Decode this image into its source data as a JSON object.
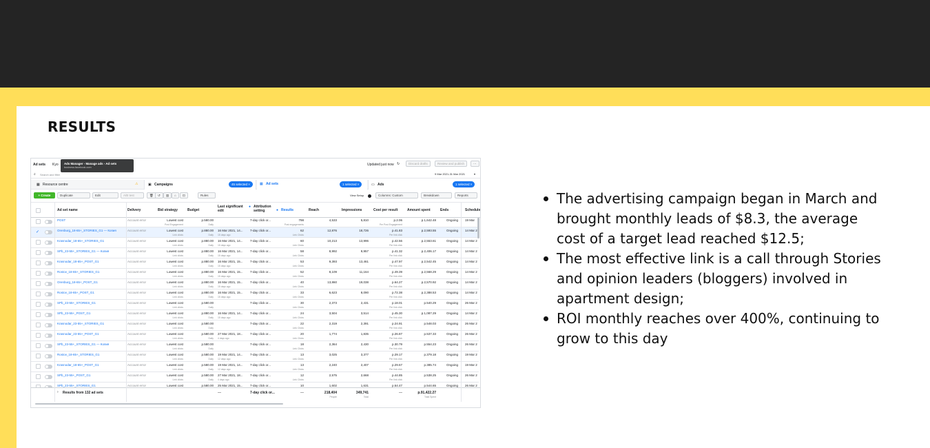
{
  "title": "RESULTS",
  "bullets": [
    "The advertising campaign began in March and brought monthly leads of $8.3, the average cost of a target lead reached $12.5;",
    "The most effective link is a call through Stories and opinion leaders (bloggers) involved in apartment design;",
    "ROI monthly reaches over 400%, continuing to grow to this day"
  ],
  "colors": {
    "top_band": "#242424",
    "accent_yellow": "#ffde59",
    "fb_blue": "#1877f2",
    "create_green": "#42b72a"
  },
  "ads": {
    "breadcrumb": "Ad sets",
    "breadcrumb_partial": "Kyo",
    "tooltip_title": "Ads Manager - Manage ads - Ad sets",
    "tooltip_url": "business.facebook.com",
    "search_placeholder": "Search and filter",
    "updated": "Updated just now",
    "discard": "Discard drafts",
    "review": "Review and publish",
    "more": "···",
    "date_range": "9 Mar 2021-31 Mar 2021",
    "resource_centre": "Resource centre",
    "campaigns_tab": "Campaigns",
    "campaigns_selected": "45 selected ×",
    "adsets_tab": "Ad sets",
    "adsets_selected": "1 selected ×",
    "ads_tab": "Ads",
    "ads_selected": "1 selected ×",
    "toolbar": {
      "create": "+ Create",
      "duplicate": "Duplicate",
      "edit": "Edit",
      "ab_test": "A/B test",
      "rules": "Rules",
      "view_setup": "View Setup",
      "columns": "Columns: Custom",
      "breakdown": "Breakdown",
      "reports": "Reports"
    },
    "columns": [
      "Ad set name",
      "Delivery",
      "Bid strategy",
      "Budget",
      "Last significant edit",
      "Attribution setting",
      "Results",
      "Reach",
      "Impressions",
      "Cost per result",
      "Amount spent",
      "Ends",
      "Schedule"
    ],
    "first_row": {
      "name": "POST",
      "delivery": "Account error",
      "bid": "Lowest cost",
      "bid_sub": "Post Engagement",
      "budget": "p.580.00",
      "budget_sub": "Daily",
      "edit": "",
      "edit_sub": "",
      "attr": "7-day click or...",
      "results": "798",
      "results_sub": "Post engagements",
      "reach": "4,533",
      "impr": "5,810",
      "cpr": "p.2.06",
      "cpr_sub": "Per Post Engagement",
      "spent": "p.1,642.48",
      "ends": "Ongoing",
      "sched": "19 Mar"
    },
    "rows": [
      {
        "name": "Orenburg_18-65+_STORIES_G1 — Копия",
        "delivery": "Account error",
        "bid": "Lowest cost",
        "bid_sub": "Link clicks",
        "budget": "p.880.00",
        "budget_sub": "Daily",
        "edit": "16 Mar 2021, 14...",
        "edit_sub": "15 days ago",
        "attr": "7-day click or...",
        "results": "62",
        "results_sub": "Link Clicks",
        "reach": "12,876",
        "impr": "18,726",
        "cpr": "p.41.83",
        "cpr_sub": "Per link click",
        "spent": "p.2,593.55",
        "ends": "Ongoing",
        "sched": "14 Mar 2"
      },
      {
        "name": "Krasnodar_18-65+_STORIES_G1",
        "delivery": "Account error",
        "bid": "Lowest cost",
        "bid_sub": "Link clicks",
        "budget": "p.880.00",
        "budget_sub": "Daily",
        "edit": "16 Mar 2021, 14...",
        "edit_sub": "15 days ago",
        "attr": "7-day click or...",
        "results": "60",
        "results_sub": "Link Clicks",
        "reach": "10,213",
        "impr": "13,996",
        "cpr": "p.42.56",
        "cpr_sub": "Per link click",
        "spent": "p.2,553.61",
        "ends": "Ongoing",
        "sched": "14 Mar 2"
      },
      {
        "name": "SPb_23-55+_STORIES_G1 — Копия",
        "delivery": "Account error",
        "bid": "Lowest cost",
        "bid_sub": "Link clicks",
        "budget": "p.880.00",
        "budget_sub": "Daily",
        "edit": "16 Mar 2021, 14...",
        "edit_sub": "15 days ago",
        "attr": "7-day click or...",
        "results": "58",
        "results_sub": "Link Clicks",
        "reach": "8,992",
        "impr": "9,957",
        "cpr": "p.41.32",
        "cpr_sub": "Per link click",
        "spent": "p.2,406.17",
        "ends": "Ongoing",
        "sched": "14 Mar 2"
      },
      {
        "name": "Krasnodar_18-65+_POST_G1",
        "delivery": "Account error",
        "bid": "Lowest cost",
        "bid_sub": "Link clicks",
        "budget": "p.880.00",
        "budget_sub": "Daily",
        "edit": "16 Mar 2021, 15...",
        "edit_sub": "15 days ago",
        "attr": "7-day click or...",
        "results": "53",
        "results_sub": "Link Clicks",
        "reach": "9,393",
        "impr": "13,461",
        "cpr": "p.47.97",
        "cpr_sub": "Per link click",
        "spent": "p.2,542.45",
        "ends": "Ongoing",
        "sched": "14 Mar 2"
      },
      {
        "name": "Rostov_18-65+_STORIES_G1",
        "delivery": "Account error",
        "bid": "Lowest cost",
        "bid_sub": "Link clicks",
        "budget": "p.880.00",
        "budget_sub": "Daily",
        "edit": "16 Mar 2021, 15...",
        "edit_sub": "15 days ago",
        "attr": "7-day click or...",
        "results": "52",
        "results_sub": "Link Clicks",
        "reach": "8,109",
        "impr": "11,164",
        "cpr": "p.49.39",
        "cpr_sub": "Per link click",
        "spent": "p.2,568.29",
        "ends": "Ongoing",
        "sched": "14 Mar 2"
      },
      {
        "name": "Orenburg_18-65+_POST_G1",
        "delivery": "Account error",
        "bid": "Lowest cost",
        "bid_sub": "Link clicks",
        "budget": "p.880.00",
        "budget_sub": "Daily",
        "edit": "16 Mar 2021, 15...",
        "edit_sub": "15 days ago",
        "attr": "7-day click or...",
        "results": "40",
        "results_sub": "Link Clicks",
        "reach": "13,860",
        "impr": "19,038",
        "cpr": "p.64.27",
        "cpr_sub": "Per link click",
        "spent": "p.2,570.92",
        "ends": "Ongoing",
        "sched": "14 Mar 2"
      },
      {
        "name": "Rostov_18-65+_POST_G1",
        "delivery": "Account error",
        "bid": "Lowest cost",
        "bid_sub": "Link clicks",
        "budget": "p.880.00",
        "budget_sub": "Daily",
        "edit": "16 Mar 2021, 15...",
        "edit_sub": "15 days ago",
        "attr": "7-day click or...",
        "results": "33",
        "results_sub": "Link Clicks",
        "reach": "6,623",
        "impr": "8,090",
        "cpr": "p.72.38",
        "cpr_sub": "Per link click",
        "spent": "p.2,388.53",
        "ends": "Ongoing",
        "sched": "14 Mar 2"
      },
      {
        "name": "SPb_23-55+_STORIES_G1",
        "delivery": "Account error",
        "bid": "Lowest cost",
        "bid_sub": "Link clicks",
        "budget": "p.580.00",
        "budget_sub": "Daily",
        "edit": "",
        "edit_sub": "",
        "attr": "7-day click or...",
        "results": "30",
        "results_sub": "Link Clicks",
        "reach": "2,373",
        "impr": "2,431",
        "cpr": "p.18.01",
        "cpr_sub": "Per link click",
        "spent": "p.540.29",
        "ends": "Ongoing",
        "sched": "26 Mar 2"
      },
      {
        "name": "SPb_23-55+_POST_G1",
        "delivery": "Account error",
        "bid": "Lowest cost",
        "bid_sub": "Link clicks",
        "budget": "p.880.00",
        "budget_sub": "Daily",
        "edit": "16 Mar 2021, 14...",
        "edit_sub": "15 days ago",
        "attr": "7-day click or...",
        "results": "24",
        "results_sub": "Link Clicks",
        "reach": "3,504",
        "impr": "3,514",
        "cpr": "p.45.30",
        "cpr_sub": "Per link click",
        "spent": "p.1,087.29",
        "ends": "Ongoing",
        "sched": "14 Mar 2"
      },
      {
        "name": "Krasnodar_23-55+_STORIES_G1",
        "delivery": "Account error",
        "bid": "Lowest cost",
        "bid_sub": "Link clicks",
        "budget": "p.580.00",
        "budget_sub": "Daily",
        "edit": "",
        "edit_sub": "",
        "attr": "7-day click or...",
        "results": "22",
        "results_sub": "Link Clicks",
        "reach": "2,319",
        "impr": "2,391",
        "cpr": "p.24.91",
        "cpr_sub": "Per link click",
        "spent": "p.548.03",
        "ends": "Ongoing",
        "sched": "26 Mar 2"
      },
      {
        "name": "Krasnodar_23-55+_POST_G1",
        "delivery": "Account error",
        "bid": "Lowest cost",
        "bid_sub": "Link clicks",
        "budget": "p.580.00",
        "budget_sub": "Daily",
        "edit": "27 Mar 2021, 18...",
        "edit_sub": "4 days ago",
        "attr": "7-day click or...",
        "results": "20",
        "results_sub": "Link Clicks",
        "reach": "1,774",
        "impr": "1,835",
        "cpr": "p.26.87",
        "cpr_sub": "Per link click",
        "spent": "p.537.33",
        "ends": "Ongoing",
        "sched": "26 Mar 2"
      },
      {
        "name": "SPb_23-55+_STORIES_G1 — Копия",
        "delivery": "Account error",
        "bid": "Lowest cost",
        "bid_sub": "Link clicks",
        "budget": "p.580.00",
        "budget_sub": "Daily",
        "edit": "",
        "edit_sub": "",
        "attr": "7-day click or...",
        "results": "18",
        "results_sub": "Link Clicks",
        "reach": "2,364",
        "impr": "2,430",
        "cpr": "p.30.79",
        "cpr_sub": "Per link click",
        "spent": "p.554.23",
        "ends": "Ongoing",
        "sched": "26 Mar 2"
      },
      {
        "name": "Rostov_18-65+_STORIES_G1",
        "delivery": "Account error",
        "bid": "Lowest cost",
        "bid_sub": "Link clicks",
        "budget": "p.580.00",
        "budget_sub": "Daily",
        "edit": "19 Mar 2021, 14...",
        "edit_sub": "12 days ago",
        "attr": "7-day click or...",
        "results": "13",
        "results_sub": "Link Clicks",
        "reach": "3,025",
        "impr": "3,377",
        "cpr": "p.29.17",
        "cpr_sub": "Per link click",
        "spent": "p.379.18",
        "ends": "Ongoing",
        "sched": "19 Mar 2"
      },
      {
        "name": "Krasnodar_18-65+_POST_G1",
        "delivery": "Account error",
        "bid": "Lowest cost",
        "bid_sub": "Link clicks",
        "budget": "p.580.00",
        "budget_sub": "Daily",
        "edit": "19 Mar 2021, 14...",
        "edit_sub": "12 days ago",
        "attr": "7-day click or...",
        "results": "13",
        "results_sub": "Link Clicks",
        "reach": "2,240",
        "impr": "2,407",
        "cpr": "p.29.67",
        "cpr_sub": "Per link click",
        "spent": "p.385.74",
        "ends": "Ongoing",
        "sched": "19 Mar 2"
      },
      {
        "name": "SPb_23-55+_POST_G1",
        "delivery": "Account error",
        "bid": "Lowest cost",
        "bid_sub": "Link clicks",
        "budget": "p.580.00",
        "budget_sub": "Daily",
        "edit": "27 Mar 2021, 18...",
        "edit_sub": "4 days ago",
        "attr": "7-day click or...",
        "results": "12",
        "results_sub": "Link Clicks",
        "reach": "2,575",
        "impr": "2,668",
        "cpr": "p.44.85",
        "cpr_sub": "Per link click",
        "spent": "p.538.25",
        "ends": "Ongoing",
        "sched": "26 Mar 2"
      },
      {
        "name": "SPb_23-55+_STORIES_G1",
        "delivery": "Account error",
        "bid": "Lowest cost",
        "bid_sub": "Link clicks",
        "budget": "p.580.00",
        "budget_sub": "Daily",
        "edit": "25 Mar 2021, 15...",
        "edit_sub": "6 days ago",
        "attr": "7-day click or...",
        "results": "10",
        "results_sub": "Link Clicks",
        "reach": "1,602",
        "impr": "1,631",
        "cpr": "p.54.47",
        "cpr_sub": "Per link click",
        "spent": "p.544.65",
        "ends": "Ongoing",
        "sched": "26 Mar 2"
      }
    ],
    "totals": {
      "label": "Results from 132 ad sets",
      "edit": "—",
      "attr": "7-day click or...",
      "results": "—",
      "reach": "218,404",
      "reach_sub": "People",
      "impr": "349,741",
      "impr_sub": "Total",
      "cpr": "—",
      "spent": "p.91,422.27",
      "spent_sub": "Total Spent"
    }
  }
}
